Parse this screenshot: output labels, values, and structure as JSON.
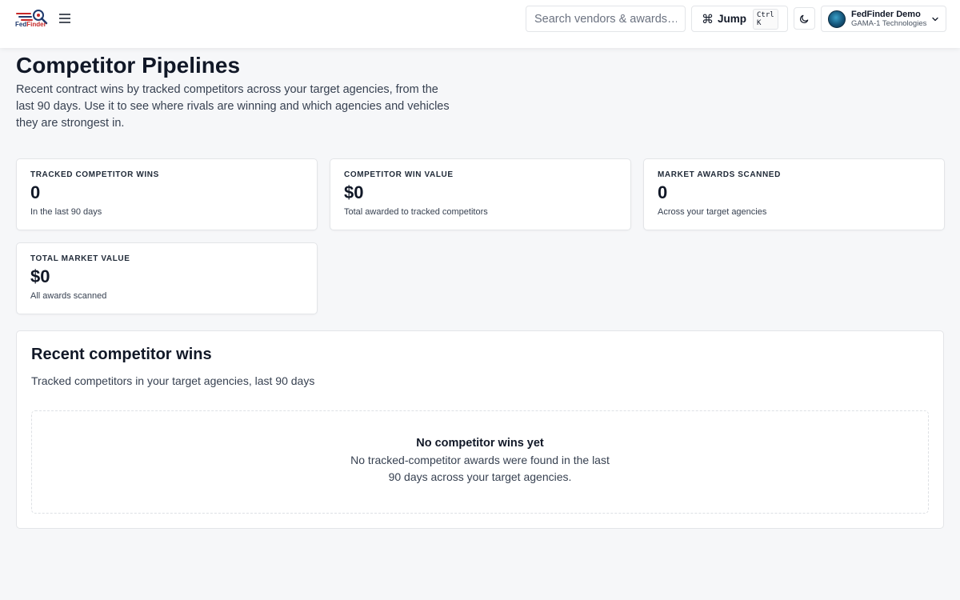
{
  "header": {
    "logo_text_main": "Fed",
    "logo_text_accent": "Finder",
    "search_placeholder": "Search vendors & awards…",
    "jump_icon": "⌘",
    "jump_label": "Jump",
    "jump_shortcut": "Ctrl K",
    "account_name": "FedFinder Demo",
    "account_org": "GAMA-1 Technologies"
  },
  "page": {
    "title": "Competitor Pipelines",
    "description": "Recent contract wins by tracked competitors across your target agencies, from the last 90 days. Use it to see where rivals are winning and which agencies and vehicles they are strongest in."
  },
  "stats": [
    {
      "label": "Tracked competitor wins",
      "value": "0",
      "sub": "In the last 90 days"
    },
    {
      "label": "Competitor win value",
      "value": "$0",
      "sub": "Total awarded to tracked competitors"
    },
    {
      "label": "Market awards scanned",
      "value": "0",
      "sub": "Across your target agencies"
    },
    {
      "label": "Total market value",
      "value": "$0",
      "sub": "All awards scanned"
    }
  ],
  "recent": {
    "title": "Recent competitor wins",
    "subtitle": "Tracked competitors in your target agencies, last 90 days",
    "empty_title": "No competitor wins yet",
    "empty_desc": "No tracked-competitor awards were found in the last 90 days across your target agencies."
  },
  "colors": {
    "background": "#f6f7f9",
    "card": "#ffffff",
    "border": "#e3e5e8",
    "text": "#111827",
    "brand_navy": "#1f3a6e",
    "brand_red": "#c62828"
  },
  "icons": {
    "logo": "fedfinder-logo-icon",
    "menu": "hamburger-menu-icon",
    "jump": "command-icon",
    "theme": "moon-icon",
    "avatar": "globe-avatar-icon",
    "dropdown": "chevron-down-icon"
  }
}
